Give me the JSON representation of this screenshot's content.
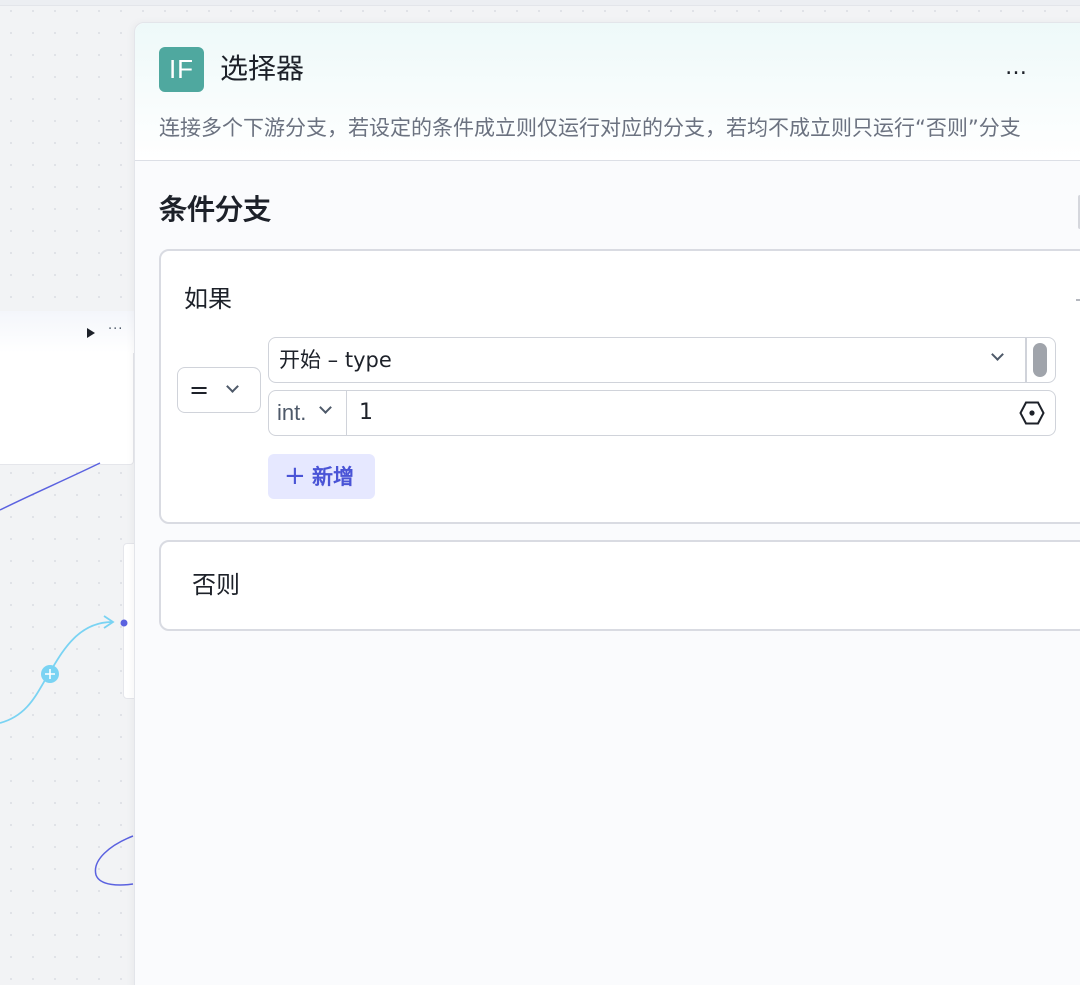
{
  "canvas": {
    "node_run_icon": "play-icon",
    "node_more_icon": "more-icon",
    "edge_colors": {
      "primary": "#5b62e0",
      "secondary": "#7ad3f3"
    }
  },
  "panel": {
    "icon_text": "IF",
    "icon_color": "#4fa89f",
    "title": "选择器",
    "more_icon": "…",
    "description": "连接多个下游分支，若设定的条件成立则仅运行对应的分支，若均不成立则只运行“否则”分支",
    "section_title": "条件分支",
    "if_branch": {
      "label": "如果",
      "operator": "=",
      "variable": "开始 – type",
      "value_type": "int.",
      "value": "1",
      "add_button_plus": "+",
      "add_button_label": "新增",
      "accent_color": "#4a54d6"
    },
    "else_branch": {
      "label": "否则"
    }
  }
}
